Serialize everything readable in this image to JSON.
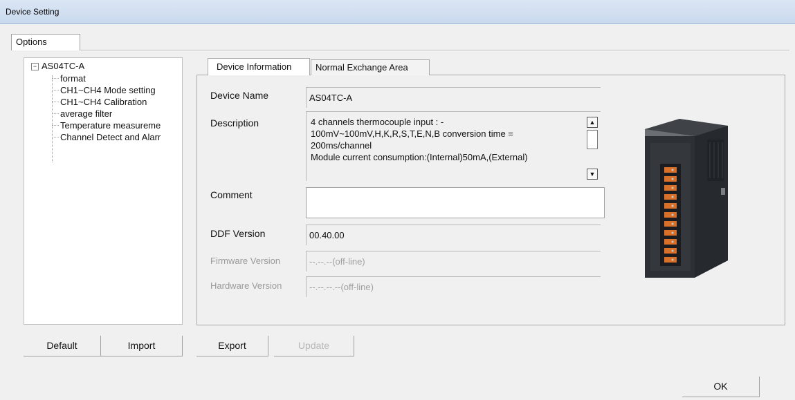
{
  "window": {
    "title": "Device Setting"
  },
  "options_tab": "Options",
  "tree": {
    "root": "AS04TC-A",
    "expander": "−",
    "items": [
      "format",
      "CH1~CH4 Mode setting",
      "CH1~CH4 Calibration",
      "average filter",
      "Temperature measureme",
      "Channel Detect and Alarr"
    ]
  },
  "tabs": {
    "device_information": "Device Information",
    "normal_exchange_area": "Normal Exchange Area"
  },
  "form": {
    "device_name_label": "Device Name",
    "device_name": "AS04TC-A",
    "description_label": "Description",
    "description_lines": [
      "4 channels thermocouple input : -",
      "100mV~100mV,H,K,R,S,T,E,N,B conversion time =",
      "200ms/channel",
      "Module current consumption:(Internal)50mA,(External)"
    ],
    "comment_label": "Comment",
    "comment": "",
    "ddf_version_label": "DDF Version",
    "ddf_version": "00.40.00",
    "firmware_version_label": "Firmware Version",
    "firmware_version": "--.--.--(off-line)",
    "hardware_version_label": "Hardware Version",
    "hardware_version": "--.--.--.--(off-line)"
  },
  "scroll": {
    "up_icon": "▲",
    "down_icon": "▼"
  },
  "buttons": {
    "default": "Default",
    "import": "Import",
    "export": "Export",
    "update": "Update",
    "ok": "OK"
  },
  "icons": {
    "expander": "collapse-icon",
    "device_image": "module-device-image"
  },
  "colors": {
    "device_body": "#2b2e33",
    "terminal": "#d9702a"
  }
}
